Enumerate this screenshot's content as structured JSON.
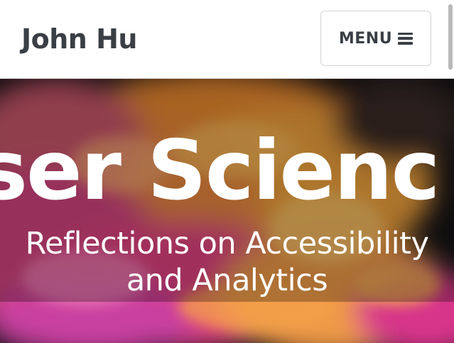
{
  "header": {
    "brand": "John Hu",
    "menu_label": "MENU",
    "menu_icon": "bars-icon"
  },
  "hero": {
    "title_fragment": "ser Scienc",
    "subtitle_line1": "Reflections on Accessibility",
    "subtitle_line2": "and Analytics",
    "background": "colorful-smoke-image"
  },
  "colors": {
    "text_dark": "#3a3f45",
    "white": "#ffffff",
    "hero_dark": "#141316",
    "smoke_orange": "#f2a13a",
    "smoke_magenta": "#e0408a",
    "smoke_pink": "#f27ab3"
  }
}
